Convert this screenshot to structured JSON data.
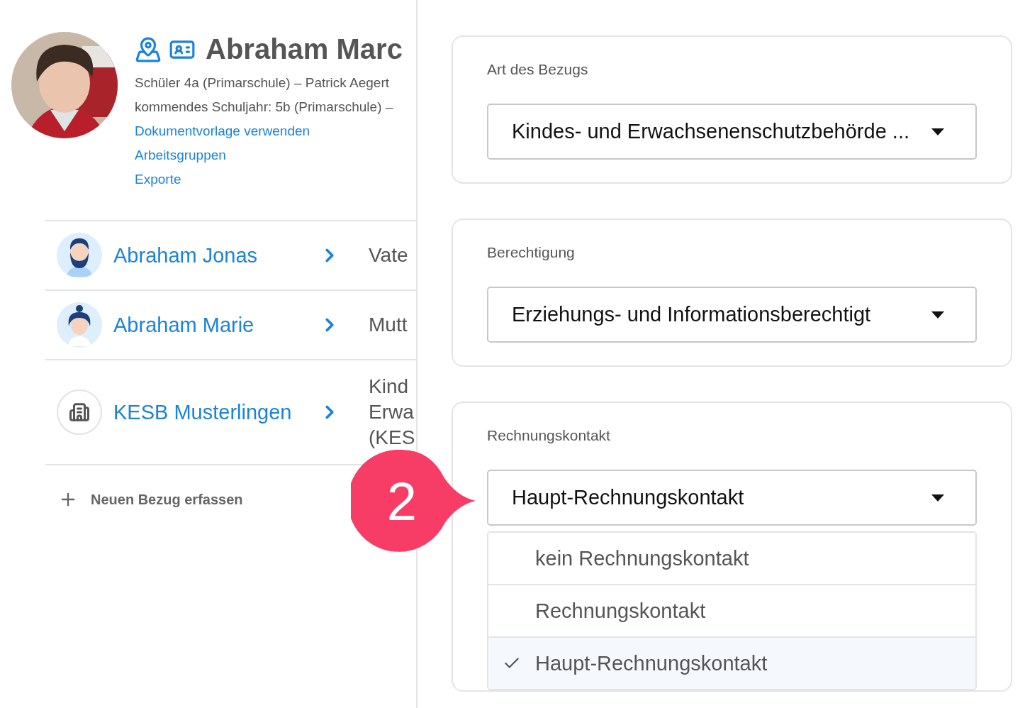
{
  "person": {
    "name": "Abraham Marc",
    "info_lines": [
      "Schüler 4a (Primarschule) – Patrick Aegert",
      "kommendes Schuljahr: 5b (Primarschule) –"
    ],
    "links": [
      "Dokumentvorlage verwenden",
      "Arbeitsgruppen",
      "Exporte"
    ]
  },
  "relations": [
    {
      "name": "Abraham Jonas",
      "kind": "man",
      "relation_lines": [
        "Vate"
      ]
    },
    {
      "name": "Abraham Marie",
      "kind": "woman",
      "relation_lines": [
        "Mutt"
      ]
    },
    {
      "name": "KESB Musterlingen",
      "kind": "organization",
      "relation_lines": [
        "Kind",
        "Erwa",
        "(KES"
      ]
    }
  ],
  "add_relation": "Neuen Bezug erfassen",
  "step_badge": "2",
  "fields": [
    {
      "label": "Art des Bezugs",
      "value": "Kindes- und Erwachsenenschutzbehörde ...",
      "expanded": false
    },
    {
      "label": "Berechtigung",
      "value": "Erziehungs- und Informationsberechtigt",
      "expanded": false
    },
    {
      "label": "Rechnungskontakt",
      "value": "Haupt-Rechnungskontakt",
      "expanded": true,
      "options": [
        {
          "label": "kein Rechnungskontakt",
          "selected": false
        },
        {
          "label": "Rechnungskontakt",
          "selected": false
        },
        {
          "label": "Haupt-Rechnungskontakt",
          "selected": true
        }
      ]
    }
  ]
}
